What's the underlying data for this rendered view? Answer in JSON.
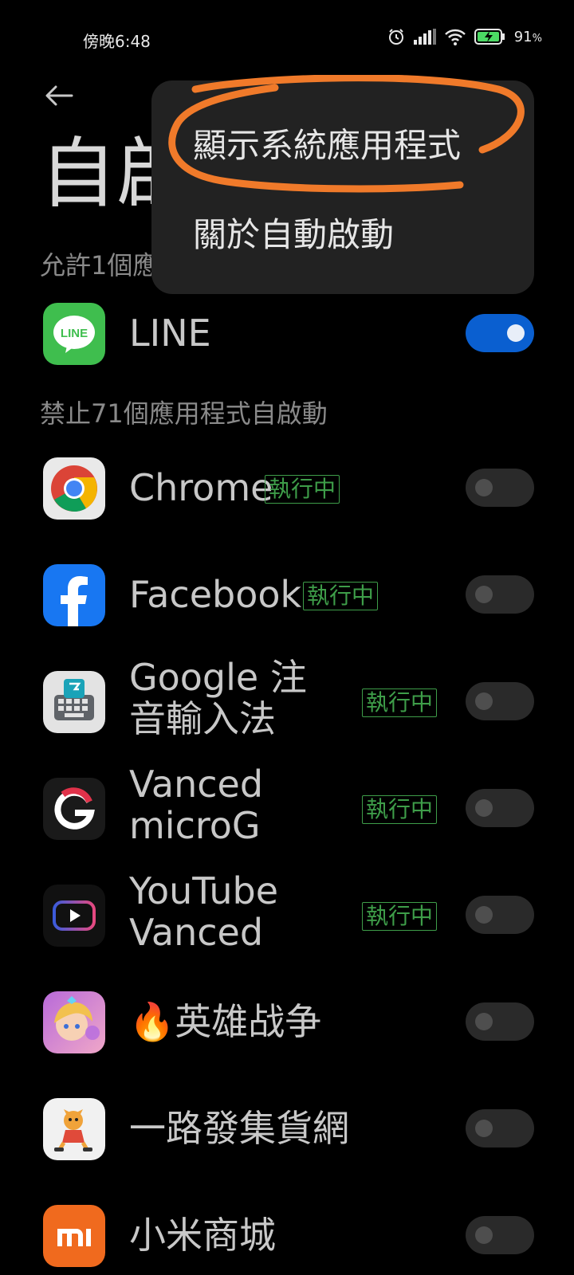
{
  "status_bar": {
    "time": "傍晚6:48",
    "battery": "91"
  },
  "page": {
    "title": "自啟",
    "allowed_header": "允許1個應用程式自啟動",
    "blocked_header": "禁止71個應用程式自啟動"
  },
  "allowed_apps": [
    {
      "name": "LINE",
      "icon": "line-icon",
      "enabled": true
    }
  ],
  "blocked_apps": [
    {
      "name": "Chrome",
      "badge": "執行中",
      "icon": "chrome-icon",
      "enabled": false
    },
    {
      "name": "Facebook",
      "badge": "執行中",
      "icon": "facebook-icon",
      "enabled": false
    },
    {
      "name": "Google 注音輸入法",
      "line1": "Google 注",
      "line2": "音輸入法",
      "badge": "執行中",
      "icon": "gboard-zhuyin-icon",
      "enabled": false
    },
    {
      "name": "Vanced microG",
      "line1": "Vanced",
      "line2": "microG",
      "badge": "執行中",
      "icon": "vanced-microg-icon",
      "enabled": false
    },
    {
      "name": "YouTube Vanced",
      "line1": "YouTube",
      "line2": "Vanced",
      "badge": "執行中",
      "icon": "youtube-vanced-icon",
      "enabled": false
    },
    {
      "name": "🔥英雄战争",
      "icon": "hero-war-game-icon",
      "enabled": false
    },
    {
      "name": "一路發集貨網",
      "icon": "yilufa-shopping-icon",
      "enabled": false
    },
    {
      "name": "小米商城",
      "icon": "mi-store-icon",
      "enabled": false
    }
  ],
  "overflow_menu": {
    "items": [
      "顯示系統應用程式",
      "關於自動啟動"
    ]
  },
  "colors": {
    "accent_toggle_on": "#0a5fd0",
    "running_badge": "#3e9d49",
    "annotation": "#f07a2a"
  }
}
